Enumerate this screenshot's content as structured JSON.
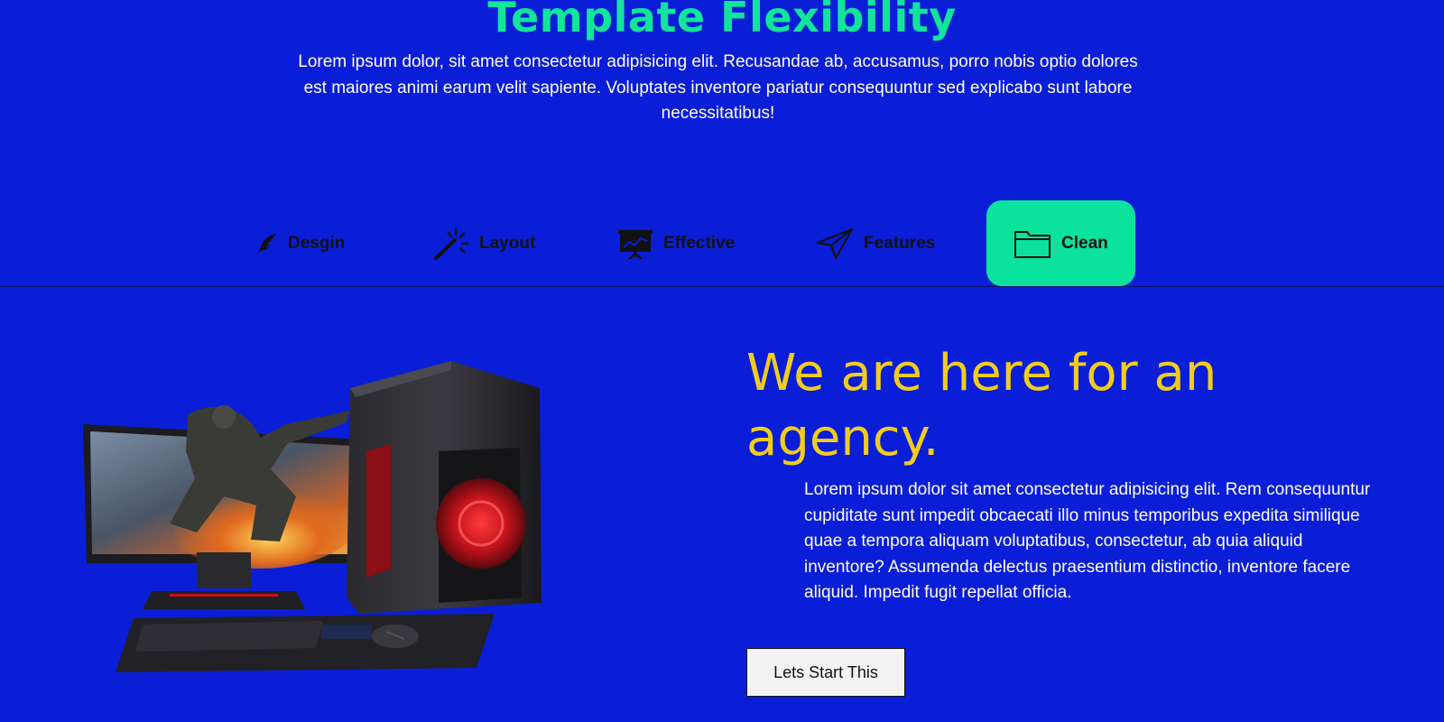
{
  "section": {
    "title": "Template Flexibility",
    "intro": "Lorem ipsum dolor, sit amet consectetur adipisicing elit. Recusandae ab, accusamus, porro nobis optio dolores est maiores animi earum velit sapiente. Voluptates inventore pariatur consequuntur sed explicabo sunt labore necessitatibus!"
  },
  "tabs": [
    {
      "label": "Desgin",
      "icon": "feather-icon",
      "active": false
    },
    {
      "label": "Layout",
      "icon": "magic-wand-icon",
      "active": false
    },
    {
      "label": "Effective",
      "icon": "presentation-chart-icon",
      "active": false
    },
    {
      "label": "Features",
      "icon": "paper-plane-icon",
      "active": false
    },
    {
      "label": "Clean",
      "icon": "folder-icon",
      "active": true
    }
  ],
  "content": {
    "headline": "We are here for an agency.",
    "body": "Lorem ipsum dolor sit amet consectetur adipisicing elit. Rem consequuntur cupiditate sunt impedit obcaecati illo minus temporibus expedita similique quae a tempora aliquam voluptatibus, consectetur, ab quia aliquid inventore? Assumenda delectus praesentium distinctio, inventore facere aliquid. Impedit fugit repellat officia.",
    "cta_label": "Lets Start This"
  },
  "colors": {
    "background": "#0a1ed8",
    "title": "#12e49a",
    "active_tab": "#0be39d",
    "headline": "#f0cc1f",
    "text": "#ffffff"
  }
}
